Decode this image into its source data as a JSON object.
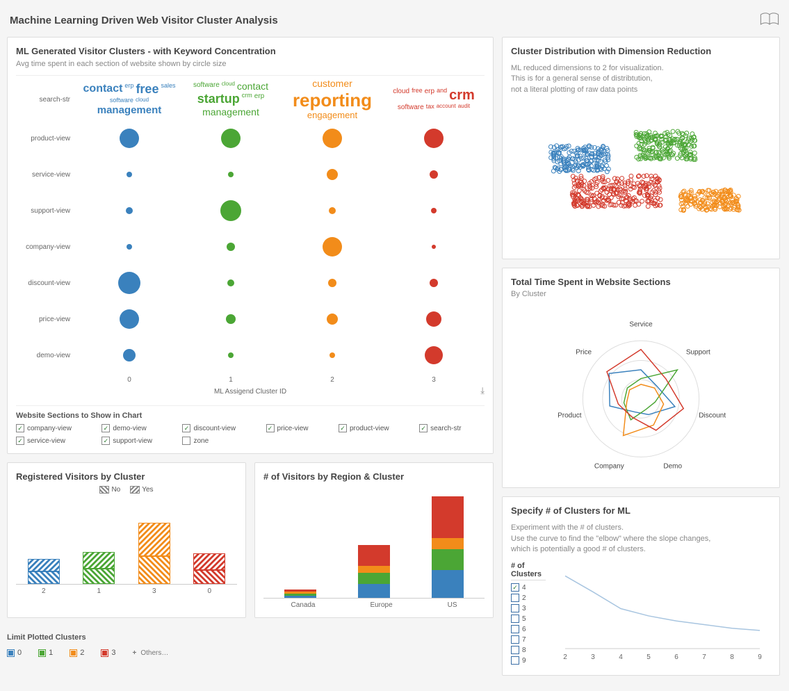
{
  "page_title": "Machine Learning Driven Web Visitor Cluster Analysis",
  "colors": {
    "c0": "#3a81bd",
    "c1": "#4ba635",
    "c2": "#f28c1a",
    "c3": "#d33a2c"
  },
  "bubble_panel": {
    "title": "ML Generated Visitor Clusters - with Keyword Concentration",
    "subtitle": "Avg time spent in each section of website shown by circle size",
    "search_str_label": "search-str",
    "x_axis_label": "ML Assigend Cluster ID",
    "section_filter_title": "Website Sections to Show in Chart",
    "section_filters": [
      {
        "label": "company-view",
        "checked": true
      },
      {
        "label": "demo-view",
        "checked": true
      },
      {
        "label": "discount-view",
        "checked": true
      },
      {
        "label": "price-view",
        "checked": true
      },
      {
        "label": "product-view",
        "checked": true
      },
      {
        "label": "search-str",
        "checked": true
      },
      {
        "label": "service-view",
        "checked": true
      },
      {
        "label": "support-view",
        "checked": true
      },
      {
        "label": "zone",
        "checked": false
      }
    ],
    "wordclouds": [
      [
        [
          "contact",
          16
        ],
        [
          "erp",
          9
        ],
        [
          "free",
          18
        ],
        [
          "sales",
          9
        ],
        [
          "software",
          9
        ],
        [
          "cloud",
          8
        ],
        [
          "management",
          15
        ]
      ],
      [
        [
          "software",
          10
        ],
        [
          "cloud",
          8
        ],
        [
          "contact",
          14
        ],
        [
          "startup",
          18
        ],
        [
          "crm",
          9
        ],
        [
          "erp",
          10
        ],
        [
          "management",
          14
        ]
      ],
      [
        [
          "customer",
          14
        ],
        [
          "reporting",
          26
        ],
        [
          "engagement",
          13
        ]
      ],
      [
        [
          "cloud",
          10
        ],
        [
          "free",
          9
        ],
        [
          "erp",
          10
        ],
        [
          "and",
          9
        ],
        [
          "crm",
          20
        ],
        [
          "software",
          10
        ],
        [
          "tax",
          9
        ],
        [
          "account",
          8
        ],
        [
          "audit",
          8
        ]
      ]
    ]
  },
  "chart_data": [
    {
      "type": "bubble-matrix",
      "title": "ML Generated Visitor Clusters - with Keyword Concentration",
      "xlabel": "ML Assigend Cluster ID",
      "x_categories": [
        "0",
        "1",
        "2",
        "3"
      ],
      "y_categories": [
        "product-view",
        "service-view",
        "support-view",
        "company-view",
        "discount-view",
        "price-view",
        "demo-view"
      ],
      "size_matrix": [
        [
          28,
          28,
          28,
          28
        ],
        [
          8,
          8,
          16,
          12
        ],
        [
          10,
          30,
          10,
          8
        ],
        [
          8,
          12,
          28,
          6
        ],
        [
          32,
          10,
          12,
          12
        ],
        [
          28,
          14,
          16,
          22
        ],
        [
          18,
          8,
          8,
          26
        ]
      ],
      "series_colors": [
        "#3a81bd",
        "#4ba635",
        "#f28c1a",
        "#d33a2c"
      ]
    },
    {
      "type": "scatter",
      "title": "Cluster Distribution with Dimension Reduction",
      "note": "ML reduced dimensions to 2 for visualization.\nThis is for a general sense of distribtution,\nnot a literal plotting of raw data points",
      "series": [
        {
          "name": "0",
          "color": "#3a81bd",
          "centroid": [
            0.25,
            0.4
          ],
          "spread": [
            0.12,
            0.1
          ],
          "n": 180
        },
        {
          "name": "1",
          "color": "#4ba635",
          "centroid": [
            0.6,
            0.3
          ],
          "spread": [
            0.12,
            0.11
          ],
          "n": 200
        },
        {
          "name": "2",
          "color": "#f28c1a",
          "centroid": [
            0.78,
            0.72
          ],
          "spread": [
            0.12,
            0.08
          ],
          "n": 170
        },
        {
          "name": "3",
          "color": "#d33a2c",
          "centroid": [
            0.4,
            0.65
          ],
          "spread": [
            0.18,
            0.12
          ],
          "n": 260
        }
      ]
    },
    {
      "type": "radar",
      "title": "Total Time Spent in Website Sections",
      "subtitle": "By Cluster",
      "categories": [
        "Service",
        "Support",
        "Discount",
        "Demo",
        "Company",
        "Product",
        "Price"
      ],
      "series": [
        {
          "name": "0",
          "color": "#3a81bd",
          "values": [
            50,
            35,
            60,
            30,
            25,
            55,
            70
          ]
        },
        {
          "name": "1",
          "color": "#4ba635",
          "values": [
            35,
            80,
            25,
            20,
            40,
            30,
            30
          ]
        },
        {
          "name": "2",
          "color": "#f28c1a",
          "values": [
            25,
            30,
            40,
            50,
            70,
            25,
            25
          ]
        },
        {
          "name": "3",
          "color": "#d33a2c",
          "values": [
            85,
            55,
            75,
            60,
            35,
            40,
            75
          ]
        }
      ]
    },
    {
      "type": "bar",
      "title": "Registered Visitors by Cluster",
      "legend": [
        "No",
        "Yes"
      ],
      "categories": [
        "2",
        "1",
        "3",
        "0"
      ],
      "series": [
        {
          "name": "No",
          "values": [
            18,
            22,
            40,
            20
          ]
        },
        {
          "name": "Yes",
          "values": [
            18,
            24,
            48,
            24
          ]
        }
      ],
      "colors_by_category": [
        "#3a81bd",
        "#4ba635",
        "#f28c1a",
        "#d33a2c"
      ],
      "ylim": [
        0,
        100
      ]
    },
    {
      "type": "bar",
      "stacked": true,
      "title": "# of Visitors by Region & Cluster",
      "categories": [
        "Canada",
        "Europe",
        "US"
      ],
      "series": [
        {
          "name": "0",
          "color": "#3a81bd",
          "values": [
            3,
            20,
            40
          ]
        },
        {
          "name": "1",
          "color": "#4ba635",
          "values": [
            3,
            16,
            30
          ]
        },
        {
          "name": "2",
          "color": "#f28c1a",
          "values": [
            3,
            10,
            16
          ]
        },
        {
          "name": "3",
          "color": "#d33a2c",
          "values": [
            3,
            30,
            60
          ]
        }
      ],
      "ylim": [
        0,
        150
      ]
    },
    {
      "type": "line",
      "title": "Specify # of Clusters for ML",
      "note": "Experiment with the # of clusters.\nUse the curve to find the \"elbow\" where the slope changes,\nwhich is potentially a good # of clusters.",
      "x": [
        2,
        3,
        4,
        5,
        6,
        7,
        8,
        9
      ],
      "series": [
        {
          "name": "inertia",
          "values": [
            100,
            78,
            55,
            45,
            38,
            33,
            28,
            25
          ]
        }
      ],
      "xlabel": "",
      "ylabel": "",
      "ylim": [
        0,
        110
      ]
    }
  ],
  "registered_panel": {
    "title": "Registered Visitors by Cluster",
    "legend_no": "No",
    "legend_yes": "Yes"
  },
  "region_panel": {
    "title": "# of Visitors by Region & Cluster"
  },
  "limit_panel": {
    "title": "Limit Plotted Clusters",
    "items": [
      {
        "label": "0",
        "color": "#3a81bd",
        "checked": true
      },
      {
        "label": "1",
        "color": "#4ba635",
        "checked": true
      },
      {
        "label": "2",
        "color": "#f28c1a",
        "checked": true
      },
      {
        "label": "3",
        "color": "#d33a2c",
        "checked": true
      }
    ],
    "others_label": "Others…"
  },
  "scatter_panel": {
    "title": "Cluster Distribution with Dimension Reduction",
    "note": "ML reduced dimensions to 2 for visualization.\nThis is for a general sense of distribtution,\nnot a literal plotting of raw data points"
  },
  "radar_panel": {
    "title": "Total Time Spent in Website Sections",
    "subtitle": "By Cluster"
  },
  "elbow_panel": {
    "title": "Specify # of Clusters for ML",
    "note": "Experiment with the # of clusters.\nUse the curve to find the \"elbow\" where the slope changes,\nwhich is potentially a good # of clusters.",
    "clusters_label": "# of Clusters",
    "options": [
      {
        "label": "4",
        "checked": true
      },
      {
        "label": "2",
        "checked": false
      },
      {
        "label": "3",
        "checked": false
      },
      {
        "label": "5",
        "checked": false
      },
      {
        "label": "6",
        "checked": false
      },
      {
        "label": "7",
        "checked": false
      },
      {
        "label": "8",
        "checked": false
      },
      {
        "label": "9",
        "checked": false
      }
    ]
  }
}
